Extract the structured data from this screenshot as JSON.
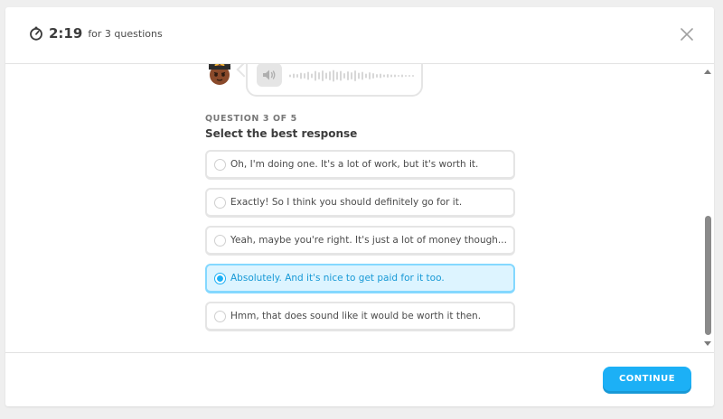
{
  "header": {
    "timer_value": "2:19",
    "timer_label": "for 3 questions",
    "timer_icon": "stopwatch-icon",
    "close_icon": "close-icon"
  },
  "audio": {
    "speaker_icon": "speaker-icon"
  },
  "question": {
    "counter": "QUESTION 3 OF 5",
    "prompt": "Select the best response"
  },
  "options": [
    {
      "label": "Oh, I'm doing one. It's a lot of work, but it's worth it.",
      "selected": false
    },
    {
      "label": "Exactly! So I think you should definitely go for it.",
      "selected": false
    },
    {
      "label": "Yeah, maybe you're right. It's just a lot of money though...",
      "selected": false
    },
    {
      "label": "Absolutely. And it's nice to get paid for it too.",
      "selected": true
    },
    {
      "label": "Hmm, that does sound like it would be worth it then.",
      "selected": false
    }
  ],
  "footer": {
    "continue_label": "CONTINUE"
  },
  "colors": {
    "accent": "#1cb0f6",
    "selected_bg": "#ddf4ff",
    "selected_border": "#84d8ff"
  }
}
